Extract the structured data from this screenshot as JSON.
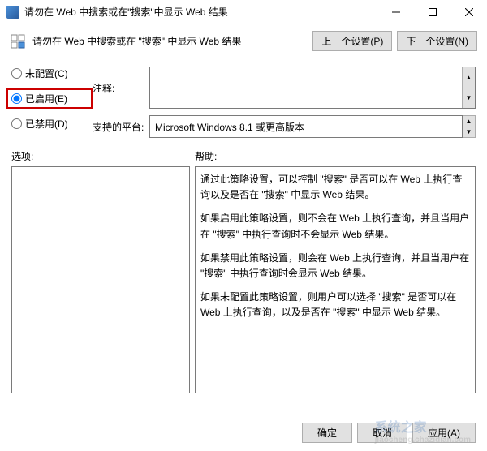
{
  "window": {
    "title": "请勿在 Web 中搜索或在\"搜索\"中显示 Web 结果"
  },
  "header": {
    "title": "请勿在 Web 中搜索或在 \"搜索\" 中显示 Web 结果",
    "prev_btn": "上一个设置(P)",
    "next_btn": "下一个设置(N)"
  },
  "radios": {
    "not_configured": "未配置(C)",
    "enabled": "已启用(E)",
    "disabled": "已禁用(D)"
  },
  "labels": {
    "comment": "注释:",
    "supported": "支持的平台:",
    "options": "选项:",
    "help": "帮助:"
  },
  "platform": "Microsoft Windows 8.1 或更高版本",
  "help": {
    "p1": "通过此策略设置，可以控制 \"搜索\" 是否可以在 Web 上执行查询以及是否在 \"搜索\" 中显示 Web 结果。",
    "p2": "如果启用此策略设置，则不会在 Web 上执行查询，并且当用户在 \"搜索\" 中执行查询时不会显示 Web 结果。",
    "p3": "如果禁用此策略设置，则会在 Web 上执行查询，并且当用户在 \"搜索\" 中执行查询时会显示 Web 结果。",
    "p4": "如果未配置此策略设置，则用户可以选择 \"搜索\" 是否可以在 Web 上执行查询，以及是否在 \"搜索\" 中显示 Web 结果。"
  },
  "buttons": {
    "ok": "确定",
    "cancel": "取消",
    "apply": "应用(A)"
  },
  "watermark": {
    "main": "系统之家",
    "sub": "jiaocheng.chazidian.com"
  }
}
